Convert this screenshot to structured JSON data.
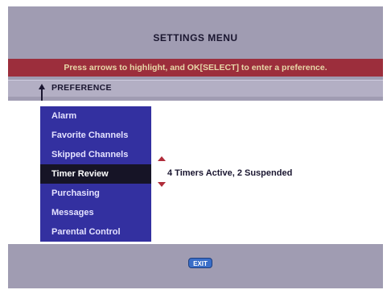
{
  "header": {
    "title": "SETTINGS MENU",
    "instruction": "Press arrows to highlight, and OK[SELECT] to enter a preference."
  },
  "preference": {
    "label": "PREFERENCE"
  },
  "menu": {
    "items": [
      {
        "label": "Alarm"
      },
      {
        "label": "Favorite Channels"
      },
      {
        "label": "Skipped Channels"
      },
      {
        "label": "Timer Review",
        "selected": true
      },
      {
        "label": "Purchasing"
      },
      {
        "label": "Messages"
      },
      {
        "label": "Parental Control"
      }
    ]
  },
  "detail": {
    "text": "4 Timers Active, 2 Suspended"
  },
  "footer": {
    "exit_label": "EXIT"
  },
  "colors": {
    "background": "#a09cb2",
    "instruction_bar": "#9c2e3c",
    "menu_bg": "#3330a0",
    "selected_bg": "#161426",
    "exit_button": "#3a6ec8"
  }
}
